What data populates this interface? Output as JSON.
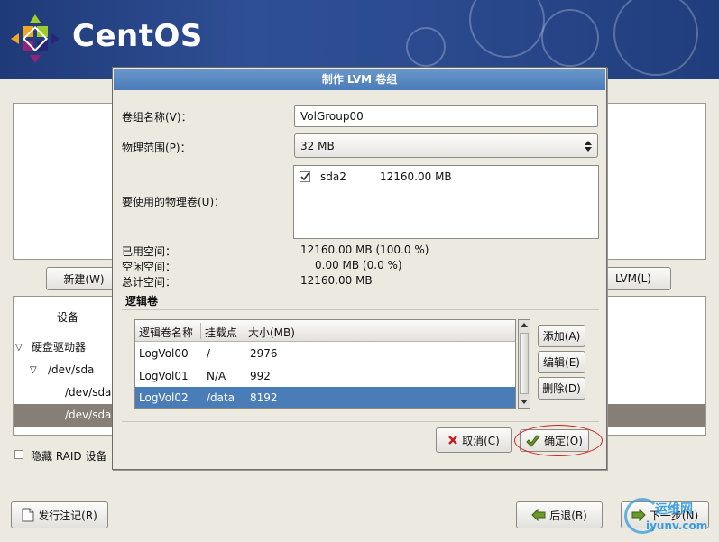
{
  "header": {
    "logo_text": "CentOS"
  },
  "main": {
    "buttons": {
      "new": "新建(W)",
      "lvm": "LVM(L)"
    },
    "device_header": "设备",
    "tree": [
      {
        "label": "硬盘驱动器",
        "expander": "▽"
      },
      {
        "label": "/dev/sda",
        "expander": "▽"
      },
      {
        "label": "/dev/sda"
      },
      {
        "label": "/dev/sda"
      }
    ],
    "hide_raid": "隐藏 RAID 设备"
  },
  "footer": {
    "release_notes": "发行注记(R)",
    "back": "后退(B)",
    "next": "下一步(N)"
  },
  "watermark": {
    "brand": "运维网",
    "url": "iyunv.com"
  },
  "dialog": {
    "title": "制作 LVM 卷组",
    "vg_name_label": "卷组名称(V)：",
    "vg_name_value": "VolGroup00",
    "pe_label": "物理范围(P)：",
    "pe_value": "32 MB",
    "pv_label": "要使用的物理卷(U)：",
    "pv_list": [
      {
        "checked": true,
        "name": "sda2",
        "size": "12160.00 MB"
      }
    ],
    "space": {
      "used_label": "已用空间：",
      "used_value": "12160.00 MB  (100.0 %)",
      "free_label": "空闲空间：",
      "free_value": "0.00 MB  (0.0 %)",
      "total_label": "总计空间：",
      "total_value": "12160.00 MB"
    },
    "lv_section": "逻辑卷",
    "lv_headers": {
      "name": "逻辑卷名称",
      "mount": "挂载点",
      "size": "大小(MB)"
    },
    "lv_rows": [
      {
        "name": "LogVol00",
        "mount": "/",
        "size": "2976"
      },
      {
        "name": "LogVol01",
        "mount": "N/A",
        "size": "992"
      },
      {
        "name": "LogVol02",
        "mount": "/data",
        "size": "8192",
        "selected": true
      }
    ],
    "lv_buttons": {
      "add": "添加(A)",
      "edit": "编辑(E)",
      "delete": "删除(D)"
    },
    "cancel": "取消(C)",
    "ok": "确定(O)",
    "colors": {
      "title_bar": "#4a7cb8",
      "selection": "#4a7cb8",
      "highlight_circle": "#cc2222"
    }
  }
}
